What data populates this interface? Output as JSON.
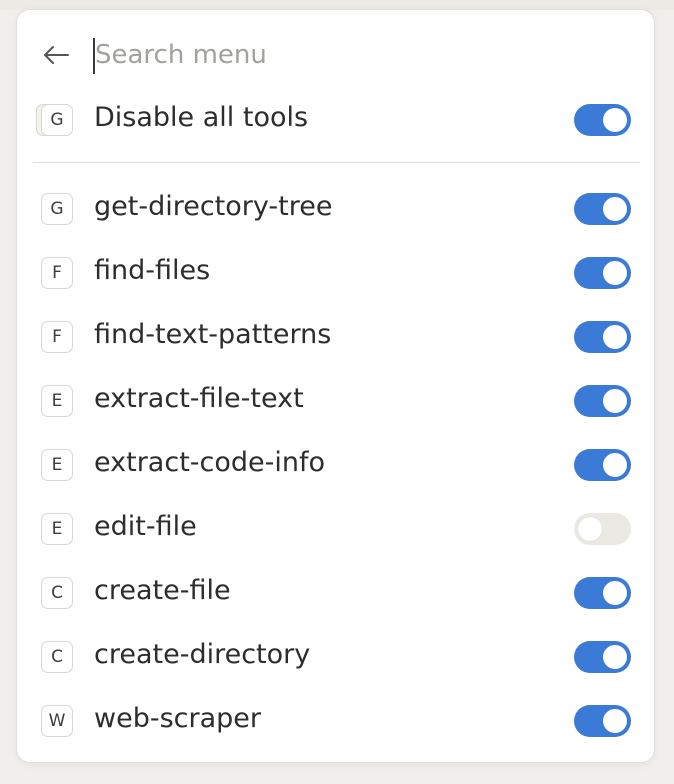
{
  "search": {
    "placeholder": "Search menu",
    "value": ""
  },
  "disable_all": {
    "badge": "G",
    "label": "Disable all tools",
    "enabled": true
  },
  "tools": [
    {
      "badge": "G",
      "label": "get-directory-tree",
      "enabled": true
    },
    {
      "badge": "F",
      "label": "find-files",
      "enabled": true
    },
    {
      "badge": "F",
      "label": "find-text-patterns",
      "enabled": true
    },
    {
      "badge": "E",
      "label": "extract-file-text",
      "enabled": true
    },
    {
      "badge": "E",
      "label": "extract-code-info",
      "enabled": true
    },
    {
      "badge": "E",
      "label": "edit-file",
      "enabled": false
    },
    {
      "badge": "C",
      "label": "create-file",
      "enabled": true
    },
    {
      "badge": "C",
      "label": "create-directory",
      "enabled": true
    },
    {
      "badge": "W",
      "label": "web-scraper",
      "enabled": true
    }
  ],
  "colors": {
    "toggle_on": "#3b7ad6",
    "toggle_off": "#ebe9e4"
  }
}
